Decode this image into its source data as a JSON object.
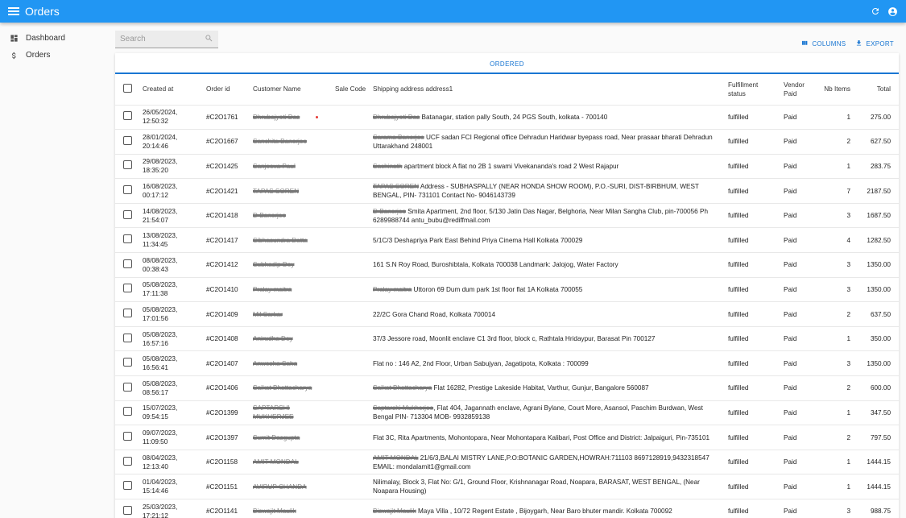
{
  "appbar": {
    "title": "Orders"
  },
  "sidebar": {
    "items": [
      {
        "label": "Dashboard"
      },
      {
        "label": "Orders"
      }
    ]
  },
  "search": {
    "placeholder": "Search"
  },
  "toolbar": {
    "columns_label": "COLUMNS",
    "export_label": "EXPORT"
  },
  "tabs": [
    {
      "label": "ORDERED"
    }
  ],
  "table": {
    "headers": {
      "created_at": "Created at",
      "order_id": "Order id",
      "customer": "Customer Name",
      "sale_code": "Sale Code",
      "address": "Shipping address address1",
      "fulfillment": "Fulfillment status",
      "vendor": "Vendor Paid",
      "items": "Nb Items",
      "total": "Total"
    },
    "rows": [
      {
        "date": "26/05/2024,",
        "time": "12:50:32",
        "id": "#C2O1761",
        "name": "Dhrubajyoti Das",
        "addr_redacted": "Dhrubajyoti Das",
        "addr": " Batanagar, station pally South, 24 PGS South, kolkata - 700140",
        "status": "fulfilled",
        "paid": "Paid",
        "items": "1",
        "total": "275.00"
      },
      {
        "date": "28/01/2024,",
        "time": "20:14:46",
        "id": "#C2O1667",
        "name": "Sanchita Banerjee",
        "addr_redacted": "Sarama Banerjee",
        "addr": " UCF sadan FCI Regional office Dehradun Haridwar byepass road, Near prasaar bharati Dehradun Uttarakhand 248001",
        "status": "fulfilled",
        "paid": "Paid",
        "items": "2",
        "total": "627.50"
      },
      {
        "date": "29/08/2023,",
        "time": "18:35:20",
        "id": "#C2O1425",
        "name": "Sanjeeva Paul",
        "addr_redacted": "Sachinath",
        "addr": " apartment block A flat no 2B 1 swami Vivekananda's road 2 West Rajapur",
        "status": "fulfilled",
        "paid": "Paid",
        "items": "1",
        "total": "283.75"
      },
      {
        "date": "16/08/2023,",
        "time": "00:17:12",
        "id": "#C2O1421",
        "name": "TAPAS SOREN",
        "addr_redacted": "TAPAS SOREN",
        "addr": " Address - SUBHASPALLY (NEAR HONDA SHOW ROOM), P.O.-SURI, DIST-BIRBHUM, WEST BENGAL, PIN- 731101 Contact No- 9046143739",
        "status": "fulfilled",
        "paid": "Paid",
        "items": "7",
        "total": "2187.50"
      },
      {
        "date": "14/08/2023,",
        "time": "21:54:07",
        "id": "#C2O1418",
        "name": "D Banerjee",
        "addr_redacted": "D Banerjee",
        "addr": " Smita Apartment, 2nd floor, 5/130 Jatin Das Nagar, Belghoria, Near Milan Sangha Club, pin-700056 Ph 6289988744 antu_bubu@rediffmail.com",
        "status": "fulfilled",
        "paid": "Paid",
        "items": "3",
        "total": "1687.50"
      },
      {
        "date": "13/08/2023,",
        "time": "11:34:45",
        "id": "#C2O1417",
        "name": "Sibhasundra Datta",
        "addr_redacted": "",
        "addr": "5/1C/3 Deshapriya Park East Behind Priya Cinema Hall Kolkata 700029",
        "status": "fulfilled",
        "paid": "Paid",
        "items": "4",
        "total": "1282.50"
      },
      {
        "date": "08/08/2023,",
        "time": "00:38:43",
        "id": "#C2O1412",
        "name": "Subhadip Dey",
        "addr_redacted": "",
        "addr": "161 S.N Roy Road, Buroshibtala, Kolkata 700038 Landmark: Jalojog, Water Factory",
        "status": "fulfilled",
        "paid": "Paid",
        "items": "3",
        "total": "1350.00"
      },
      {
        "date": "05/08/2023,",
        "time": "17:11:38",
        "id": "#C2O1410",
        "name": "Pralay maitra",
        "addr_redacted": "Pralay maitra",
        "addr": " Uttoron 69 Dum dum park 1st floor flat 1A Kolkata 700055",
        "status": "fulfilled",
        "paid": "Paid",
        "items": "3",
        "total": "1350.00"
      },
      {
        "date": "05/08/2023,",
        "time": "17:01:56",
        "id": "#C2O1409",
        "name": "Mil Sarkar",
        "addr_redacted": "",
        "addr": "22/2C Gora Chand Road, Kolkata 700014",
        "status": "fulfilled",
        "paid": "Paid",
        "items": "2",
        "total": "637.50"
      },
      {
        "date": "05/08/2023,",
        "time": "16:57:16",
        "id": "#C2O1408",
        "name": "Anirudha Dey",
        "addr_redacted": "",
        "addr": "37/3 Jessore road, Moonlit enclave C1 3rd floor, block c, Rathtala Hridaypur, Barasat Pin 700127",
        "status": "fulfilled",
        "paid": "Paid",
        "items": "1",
        "total": "350.00"
      },
      {
        "date": "05/08/2023,",
        "time": "16:56:41",
        "id": "#C2O1407",
        "name": "Anwesha Saha",
        "addr_redacted": "",
        "addr": "Flat no : 146 A2, 2nd Floor, Urban Sabujyan, Jagatipota, Kolkata : 700099",
        "status": "fulfilled",
        "paid": "Paid",
        "items": "3",
        "total": "1350.00"
      },
      {
        "date": "05/08/2023,",
        "time": "08:56:17",
        "id": "#C2O1406",
        "name": "Saikat Bhattacharya",
        "addr_redacted": "Saikat Bhattacharya",
        "addr": " Flat 16282, Prestige Lakeside Habitat, Varthur, Gunjur, Bangalore 560087",
        "status": "fulfilled",
        "paid": "Paid",
        "items": "2",
        "total": "600.00"
      },
      {
        "date": "15/07/2023,",
        "time": "09:54:15",
        "id": "#C2O1399",
        "name": "SAPTARSHI MUKHERJEE",
        "addr_redacted": "Saptarshi Mukherjee",
        "addr": ", Flat 404, Jagannath enclave, Agrani Bylane, Court More, Asansol, Paschim Burdwan, West Bengal PIN- 713304 MOB- 9932859138",
        "status": "fulfilled",
        "paid": "Paid",
        "items": "1",
        "total": "347.50"
      },
      {
        "date": "09/07/2023,",
        "time": "11:09:50",
        "id": "#C2O1397",
        "name": "Sumit Dasgupta",
        "addr_redacted": "",
        "addr": "Flat 3C, Rita Apartments, Mohontopara, Near Mohontapara Kalibari, Post Office and District: Jalpaiguri, Pin-735101",
        "status": "fulfilled",
        "paid": "Paid",
        "items": "2",
        "total": "797.50"
      },
      {
        "date": "08/04/2023,",
        "time": "12:13:40",
        "id": "#C2O1158",
        "name": "AMIT MONDAL",
        "addr_redacted": "AMIT MONDAL",
        "addr": " 21/6/3,BALAI MISTRY LANE,P.O:BOTANIC GARDEN,HOWRAH:711103 8697128919,9432318547 EMAIL: mondalamit1@gmail.com",
        "status": "fulfilled",
        "paid": "Paid",
        "items": "1",
        "total": "1444.15"
      },
      {
        "date": "01/04/2023,",
        "time": "15:14:46",
        "id": "#C2O1151",
        "name": "AVIRUP CHANDA",
        "addr_redacted": "",
        "addr": "Nilimalay, Block 3, Flat No: G/1, Ground Floor, Krishnanagar Road, Noapara, BARASAT, WEST BENGAL, (Near Noapara Housing)",
        "status": "fulfilled",
        "paid": "Paid",
        "items": "1",
        "total": "1444.15"
      },
      {
        "date": "25/03/2023,",
        "time": "17:21:12",
        "id": "#C2O1141",
        "name": "Biswajit Maulik",
        "addr_redacted": "Biswajit Maulik",
        "addr": " Maya Villa , 10/72 Regent Estate , Bijoygarh, Near Baro bhuter mandir. Kolkata 700092",
        "status": "fulfilled",
        "paid": "Paid",
        "items": "3",
        "total": "988.75"
      }
    ]
  }
}
